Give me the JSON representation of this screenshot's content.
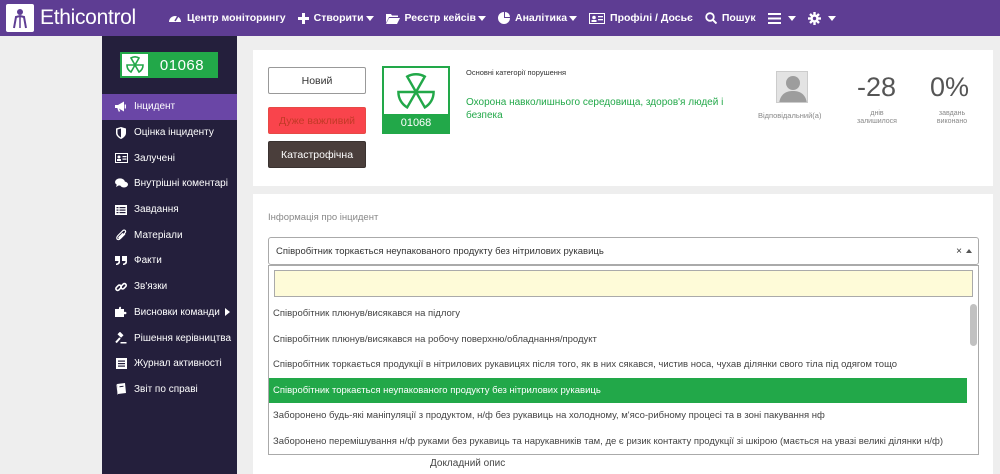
{
  "app": {
    "logo_text": "Ethicontrol"
  },
  "nav": {
    "items": [
      {
        "label": "Центр моніторингу",
        "icon": "dashboard-icon",
        "has_caret": false
      },
      {
        "label": "Створити",
        "icon": "plus-icon",
        "has_caret": true
      },
      {
        "label": "Реєстр кейсів",
        "icon": "folder-icon",
        "has_caret": true
      },
      {
        "label": "Аналітика",
        "icon": "pie-chart-icon",
        "has_caret": true
      },
      {
        "label": "Профілі / Досьє",
        "icon": "id-card-icon",
        "has_caret": false
      },
      {
        "label": "Пошук",
        "icon": "search-icon",
        "has_caret": false
      }
    ]
  },
  "sidebar": {
    "case_number": "01068",
    "items": [
      {
        "label": "Інцидент",
        "icon": "megaphone-icon",
        "active": true
      },
      {
        "label": "Оцінка інциденту",
        "icon": "shield-icon"
      },
      {
        "label": "Залучені",
        "icon": "id-card-icon"
      },
      {
        "label": "Внутрішні коментарі",
        "icon": "comments-icon"
      },
      {
        "label": "Завдання",
        "icon": "tasks-icon"
      },
      {
        "label": "Матеріали",
        "icon": "paperclip-icon"
      },
      {
        "label": "Факти",
        "icon": "quote-icon"
      },
      {
        "label": "Зв'язки",
        "icon": "link-icon"
      },
      {
        "label": "Висновки команди",
        "icon": "puzzle-icon",
        "has_arrow": true
      },
      {
        "label": "Рішення керівництва",
        "icon": "gavel-icon"
      },
      {
        "label": "Журнал активності",
        "icon": "list-icon"
      },
      {
        "label": "Звіт по справі",
        "icon": "book-icon"
      }
    ]
  },
  "case_panel": {
    "status_new": "Новий",
    "priority": "Дуже важливий",
    "severity": "Катастрофічна",
    "case_number": "01068",
    "categories_title": "Основні категорії порушення",
    "category": "Охорона навколишнього середовища, здоров'я людей і безпека",
    "responsible_label": "Відповідальний(а)",
    "days_value": "-28",
    "days_label": "днів залишилося",
    "tasks_value": "0%",
    "tasks_label": "завдань виконано"
  },
  "incident": {
    "section_title": "Інформація про інцидент",
    "selected": "Співробітник торкається неупакованого продукту без нітрилових рукавиць",
    "clear_label": "×",
    "options": [
      "Співробітник плюнув/висякався на підлогу",
      "Співробітник плюнув/висякався на робочу поверхню/обладнання/продукт",
      "Співробітник торкається продукції в нітрилових рукавицях після того, як в них сякався, чистив носа, чухав ділянки свого тіла під одягом тощо",
      "Співробітник торкається неупакованого продукту без нітрилових рукавиць",
      "Заборонено будь-які маніпуляції з продуктом, н/ф без рукавиць на холодному, м'ясо-рибному процесі та в зоні пакування нф",
      "Заборонено перемішування н/ф руками без рукавиць та нарукавників там, де є ризик контакту продукції зі шкірою (мається на увазі великі ділянки н/ф)"
    ],
    "selected_index": 3,
    "description_label": "Докладний опис"
  },
  "colors": {
    "navbar": "#5e3d93",
    "sidebar": "#241f3c",
    "sidebar_active": "#6a46a6",
    "accent_green": "#22a849",
    "danger": "#f9444c",
    "catastrophic": "#4a3e3b"
  }
}
